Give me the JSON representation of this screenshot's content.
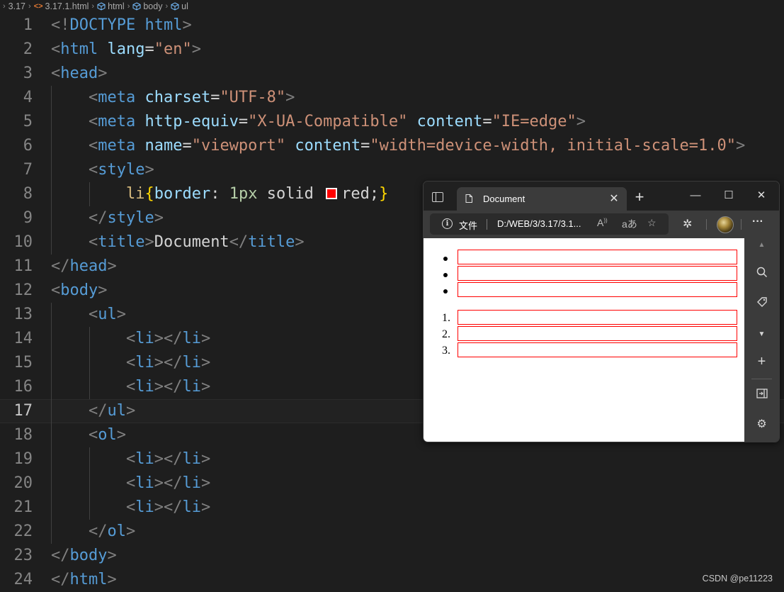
{
  "breadcrumb": {
    "items": [
      "3.17",
      "3.17.1.html",
      "html",
      "body",
      "ul"
    ]
  },
  "editor": {
    "current_line": 17,
    "line_numbers": [
      "1",
      "2",
      "3",
      "4",
      "5",
      "6",
      "7",
      "8",
      "9",
      "10",
      "11",
      "12",
      "13",
      "14",
      "15",
      "16",
      "17",
      "18",
      "19",
      "20",
      "21",
      "22",
      "23",
      "24"
    ],
    "lines": [
      "<!DOCTYPE html>",
      "<html lang=\"en\">",
      "<head>",
      "    <meta charset=\"UTF-8\">",
      "    <meta http-equiv=\"X-UA-Compatible\" content=\"IE=edge\">",
      "    <meta name=\"viewport\" content=\"width=device-width, initial-scale=1.0\">",
      "    <style>",
      "        li{border: 1px solid  red;}",
      "    </style>",
      "    <title>Document</title>",
      "</head>",
      "<body>",
      "    <ul>",
      "        <li></li>",
      "        <li></li>",
      "        <li></li>",
      "    </ul>",
      "    <ol>",
      "        <li></li>",
      "        <li></li>",
      "        <li></li>",
      "    </ol>",
      "</body>",
      "</html>"
    ],
    "color_swatch": "#ff0000"
  },
  "browser": {
    "tab_title": "Document",
    "tab_close": "✕",
    "new_tab": "+",
    "window_buttons": {
      "minimize": "—",
      "maximize": "☐",
      "close": "✕"
    },
    "address": {
      "info": "i",
      "file_label": "文件",
      "url": "D:/WEB/3/3.17/3.1..."
    },
    "page": {
      "unordered_items": 3,
      "ordered_labels": [
        "1.",
        "2.",
        "3."
      ],
      "item_border_color": "#ff0000"
    }
  },
  "watermark": "CSDN @pe11223",
  "icons": [
    "html-file-icon",
    "element-cube-icon",
    "tab-actions-icon",
    "document-icon",
    "info-icon",
    "read-aloud-icon",
    "translate-icon",
    "favorites-icon",
    "extensions-icon",
    "profile-avatar",
    "more-icon",
    "collapse-icon",
    "search-icon",
    "tag-icon",
    "add-icon",
    "split-screen-icon",
    "settings-icon"
  ]
}
